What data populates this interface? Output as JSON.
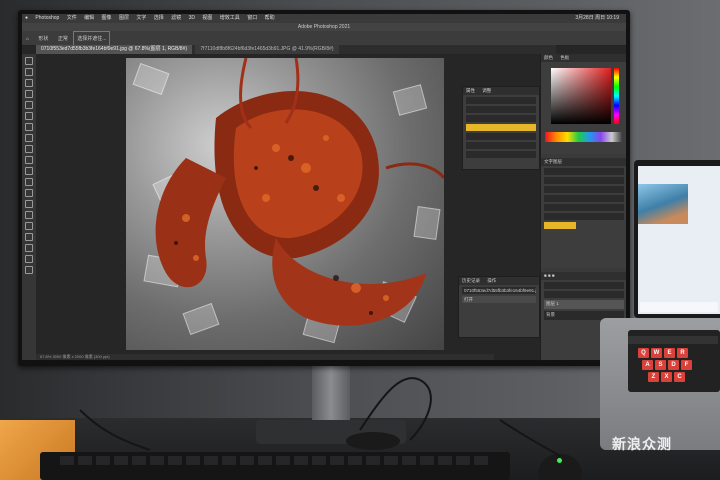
{
  "menubar": {
    "items": [
      "Photoshop",
      "文件",
      "编辑",
      "图像",
      "图层",
      "文字",
      "选择",
      "滤镜",
      "3D",
      "视图",
      "增效工具",
      "窗口",
      "帮助"
    ],
    "clock": "3月28日 周日 10:19"
  },
  "app": {
    "title": "Adobe Photoshop 2021"
  },
  "optionsbar": {
    "shape_label": "形状",
    "mode_label": "正常",
    "button": "选择并遮住..."
  },
  "tabs": [
    {
      "label": "0710f553ed7d55fb3b3fe164bf9e91.jpg @ 67.8%(图层 1, RGB/8#)",
      "active": true
    },
    {
      "label": "7f7110df8b8f624bf6d3fe1465d3b91.JPG @ 41.9%(RGB/8#)",
      "active": false
    }
  ],
  "statusbar": {
    "text": "67.8%  3000 像素 x 2000 像素 (300 ppi)"
  },
  "panels": {
    "properties_tabs": [
      "属性",
      "调整"
    ],
    "layers_tabs": [
      "历史记录",
      "操作"
    ],
    "history_file": "0710f553ed7d55fb3b3fe164bf9e91.jpg",
    "history_row": "打开",
    "right_tabs": [
      "颜色",
      "色板"
    ],
    "char_title": "文字图层",
    "layer_name": "图层 1",
    "bg_layer": "背景"
  },
  "laptop": {
    "keys": [
      "Q",
      "W",
      "E",
      "R",
      "A",
      "S",
      "D",
      "F",
      "Z",
      "X",
      "C"
    ]
  },
  "watermark": {
    "text": "新浪众测"
  },
  "colors": {
    "accent": "#e8b729",
    "ps_bg": "#262626",
    "led": "#3ef05a",
    "keycap": "#d8423a"
  }
}
